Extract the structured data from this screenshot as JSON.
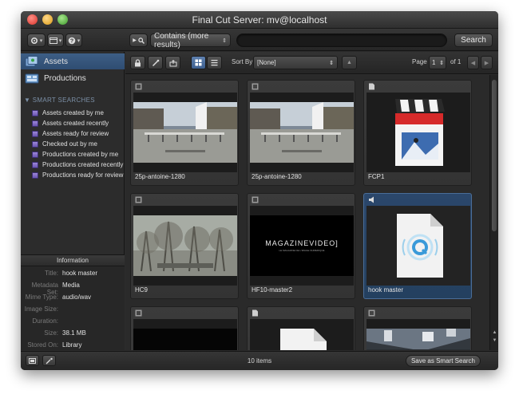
{
  "window": {
    "title": "Final Cut Server: mv@localhost"
  },
  "toolbar": {
    "search_scope": "Contains (more results)",
    "search_value": "",
    "search_button": "Search",
    "caret": "▾",
    "updown": "⇕"
  },
  "sidebar": {
    "items": [
      {
        "label": "Assets",
        "selected": true
      },
      {
        "label": "Productions",
        "selected": false
      }
    ],
    "smart_header": "▼ SMART SEARCHES",
    "smart_searches": [
      "Assets created by me",
      "Assets created recently",
      "Assets ready for review",
      "Checked out by me",
      "Productions created by me",
      "Productions created recently",
      "Productions ready for review"
    ]
  },
  "info": {
    "header": "Information",
    "rows": [
      {
        "key": "Title:",
        "value": "hook master"
      },
      {
        "key": "Metadata Set:",
        "value": "Media"
      },
      {
        "key": "Mime Type:",
        "value": "audio/wav"
      },
      {
        "key": "Image Size:",
        "value": ""
      },
      {
        "key": "Duration:",
        "value": ""
      },
      {
        "key": "Size:",
        "value": "38.1 MB"
      },
      {
        "key": "Stored On:",
        "value": "Library"
      }
    ]
  },
  "content_toolbar": {
    "sort_by_label": "Sort By",
    "sort_value": "[None]",
    "page_label": "Page",
    "page_value": "1",
    "of_label": "of 1"
  },
  "assets": [
    {
      "name": "25p-antoine-1280",
      "type": "video",
      "thumb": "street",
      "selected": false
    },
    {
      "name": "25p-antoine-1280",
      "type": "video",
      "thumb": "street",
      "selected": false
    },
    {
      "name": "FCP1",
      "type": "document",
      "thumb": "fcp-icon",
      "selected": false
    },
    {
      "name": "HC9",
      "type": "video",
      "thumb": "trees",
      "selected": false
    },
    {
      "name": "HF10-master2",
      "type": "video",
      "thumb": "magazine",
      "selected": false
    },
    {
      "name": "hook master",
      "type": "audio",
      "thumb": "quicktime-icon",
      "selected": true
    },
    {
      "name": "",
      "type": "video",
      "thumb": "black",
      "selected": false
    },
    {
      "name": "",
      "type": "document",
      "thumb": "doc-icon",
      "selected": false
    },
    {
      "name": "",
      "type": "video",
      "thumb": "interior",
      "selected": false
    }
  ],
  "thumb_text": {
    "magazine": "MAGAZINEVIDEO]",
    "magazine_sub": "LE MAGAZINE DE L'IMAGE NUMERIQUE"
  },
  "status": {
    "items_count": "10 items",
    "save_smart_search": "Save as Smart Search"
  },
  "colors": {
    "selection": "#3d5e86",
    "window_bg": "#2b2b2b",
    "tile_bg": "#383838"
  }
}
